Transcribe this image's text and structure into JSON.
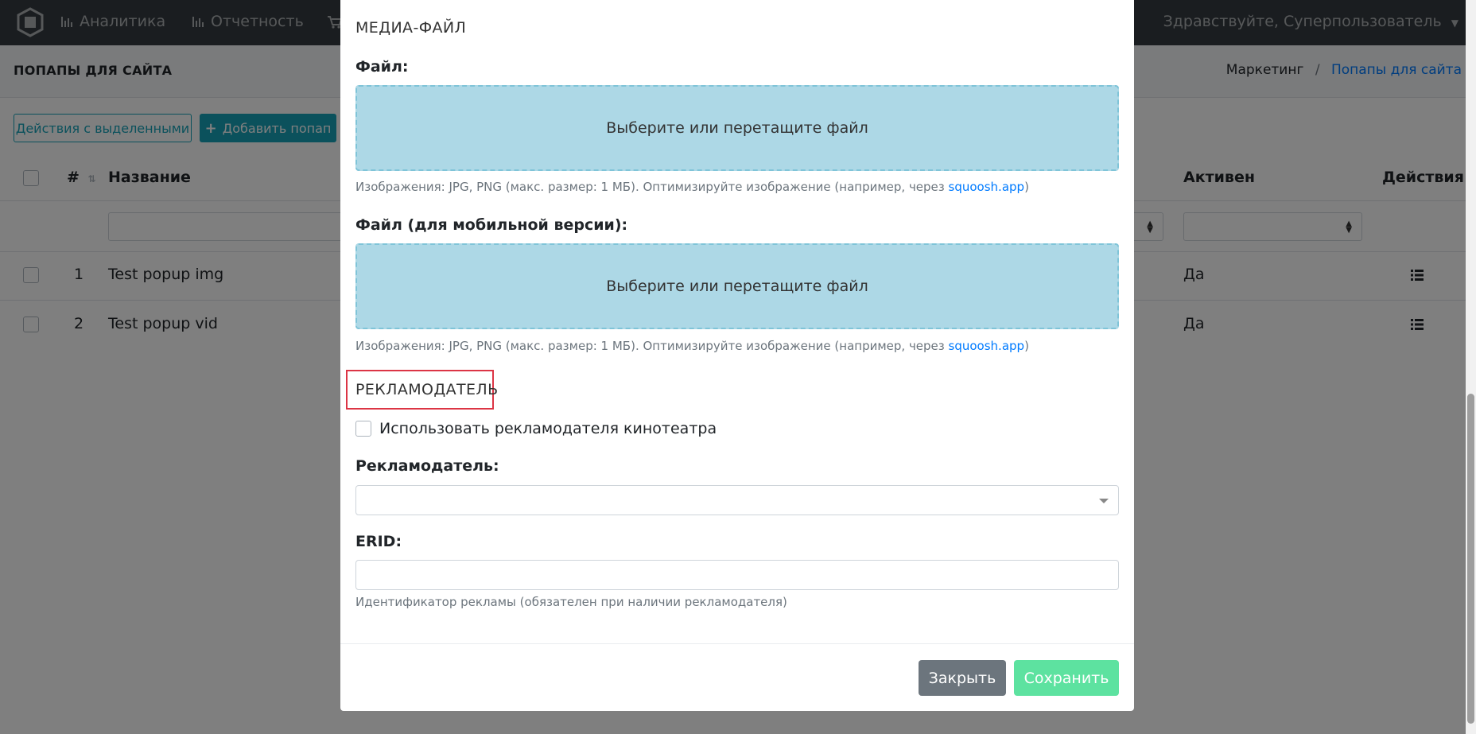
{
  "navbar": {
    "items": [
      "Аналитика",
      "Отчетность"
    ],
    "greeting": "Здравствуйте, Суперпользователь"
  },
  "header": {
    "title": "ПОПАПЫ ДЛЯ САЙТА",
    "breadcrumb": [
      "Маркетинг",
      "Попапы для сайта"
    ],
    "separator": "/"
  },
  "toolbar": {
    "bulk_actions": "Действия с выделенными",
    "add_popup": "Добавить попап"
  },
  "table": {
    "columns": {
      "number": "#",
      "name": "Название",
      "active": "Активен",
      "actions": "Действия"
    },
    "rows": [
      {
        "number": "1",
        "name": "Test popup img",
        "active": "Да"
      },
      {
        "number": "2",
        "name": "Test popup vid",
        "active": "Да"
      }
    ]
  },
  "modal": {
    "media_section": "МЕДИА-ФАЙЛ",
    "file_label": "Файл:",
    "dropzone_text": "Выберите или перетащите файл",
    "hint_text": "Изображения: JPG, PNG (макс. размер: 1 МБ). Оптимизируйте изображение (например, через ",
    "hint_link": "squoosh.app",
    "hint_close": ")",
    "mobile_file_label": "Файл (для мобильной версии):",
    "advertiser_section": "РЕКЛАМОДАТЕЛЬ",
    "use_cinema_advertiser": "Использовать рекламодателя кинотеатра",
    "advertiser_label": "Рекламодатель:",
    "erid_label": "ERID:",
    "erid_hint": "Идентификатор рекламы (обязателен при наличии рекламодателя)",
    "close_button": "Закрыть",
    "save_button": "Сохранить"
  },
  "colors": {
    "navbar": "#343a40",
    "accent": "#17a2b8",
    "dropzone": "#add8e6",
    "highlight": "#dc3545",
    "save": "#5de2a0",
    "close": "#6c757d"
  }
}
